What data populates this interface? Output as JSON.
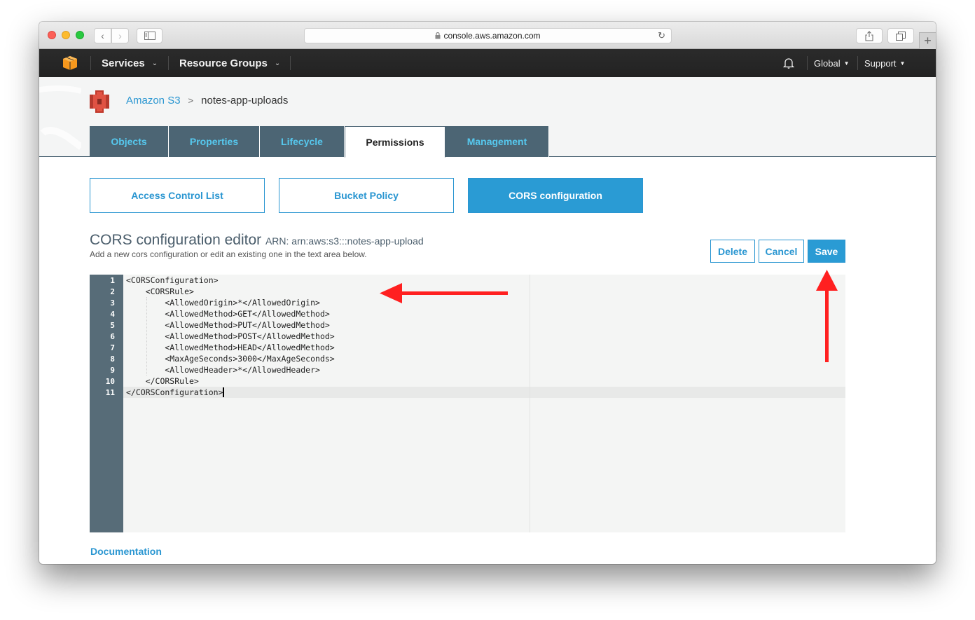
{
  "browser": {
    "url": "console.aws.amazon.com",
    "lock_icon": "lock-icon"
  },
  "awsnav": {
    "services_label": "Services",
    "resource_groups_label": "Resource Groups",
    "region_label": "Global",
    "support_label": "Support"
  },
  "breadcrumb": {
    "service": "Amazon S3",
    "separator": ">",
    "bucket": "notes-app-uploads"
  },
  "tabs": [
    {
      "label": "Objects",
      "active": false
    },
    {
      "label": "Properties",
      "active": false
    },
    {
      "label": "Lifecycle",
      "active": false
    },
    {
      "label": "Permissions",
      "active": true
    },
    {
      "label": "Management",
      "active": false
    }
  ],
  "subtabs": [
    {
      "label": "Access Control List",
      "active": false
    },
    {
      "label": "Bucket Policy",
      "active": false
    },
    {
      "label": "CORS configuration",
      "active": true
    }
  ],
  "editor": {
    "title": "CORS configuration editor",
    "arn": "ARN: arn:aws:s3:::notes-app-upload",
    "subtitle": "Add a new cors configuration or edit an existing one in the text area below.",
    "delete_label": "Delete",
    "cancel_label": "Cancel",
    "save_label": "Save",
    "lines": [
      {
        "num": "1",
        "text": "<CORSConfiguration>"
      },
      {
        "num": "2",
        "text": "    <CORSRule>"
      },
      {
        "num": "3",
        "text": "        <AllowedOrigin>*</AllowedOrigin>"
      },
      {
        "num": "4",
        "text": "        <AllowedMethod>GET</AllowedMethod>"
      },
      {
        "num": "5",
        "text": "        <AllowedMethod>PUT</AllowedMethod>"
      },
      {
        "num": "6",
        "text": "        <AllowedMethod>POST</AllowedMethod>"
      },
      {
        "num": "7",
        "text": "        <AllowedMethod>HEAD</AllowedMethod>"
      },
      {
        "num": "8",
        "text": "        <MaxAgeSeconds>3000</MaxAgeSeconds>"
      },
      {
        "num": "9",
        "text": "        <AllowedHeader>*</AllowedHeader>"
      },
      {
        "num": "10",
        "text": "    </CORSRule>"
      },
      {
        "num": "11",
        "text": "</CORSConfiguration>"
      }
    ]
  },
  "footer": {
    "documentation_label": "Documentation"
  },
  "annotations": {
    "arrow_color": "#ff2020"
  },
  "colors": {
    "accent": "#2a96d1",
    "tab_bg": "#4c6574",
    "tab_text": "#56c8ee",
    "aws_orange": "#f7981d",
    "s3_red": "#e05243"
  }
}
